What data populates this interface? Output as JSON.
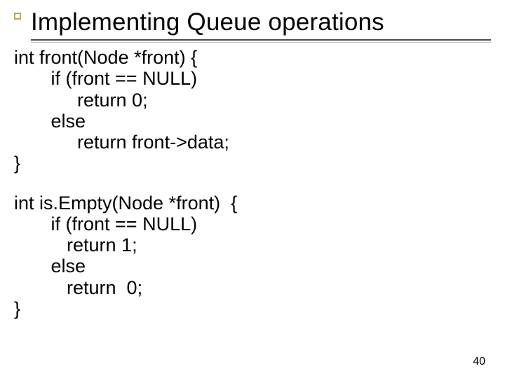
{
  "title": "Implementing Queue operations",
  "code1": "int front(Node *front) {\n       if (front == NULL)\n            return 0;\n       else\n            return front->data;\n}",
  "code2": "int is.Empty(Node *front)  {\n       if (front == NULL)\n          return 1;\n       else\n          return  0;\n}",
  "page": "40"
}
